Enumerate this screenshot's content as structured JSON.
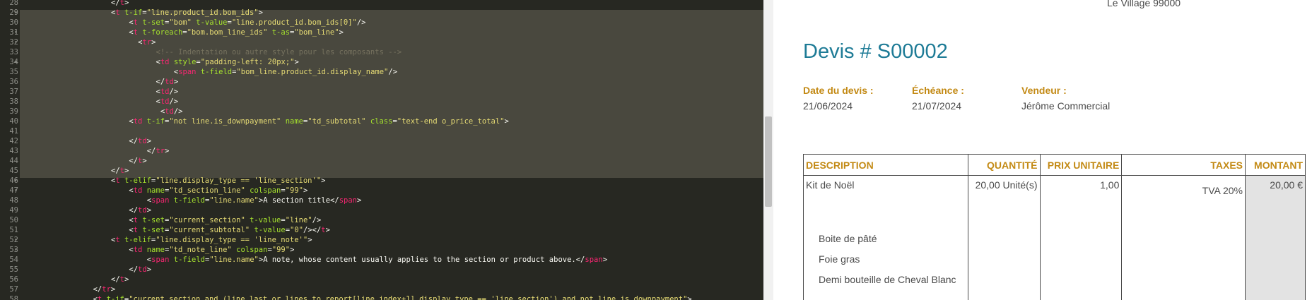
{
  "editor": {
    "lines": [
      {
        "n": "28",
        "fold": "",
        "ind": 20,
        "tokens": [
          [
            "punc",
            "</"
          ],
          [
            "tag",
            "t"
          ],
          [
            "punc",
            ">"
          ]
        ]
      },
      {
        "n": "29",
        "fold": "▾",
        "ind": 20,
        "tokens": [
          [
            "punc",
            "<"
          ],
          [
            "tag",
            "t"
          ],
          [
            "text",
            " "
          ],
          [
            "attr",
            "t-if"
          ],
          [
            "punc",
            "="
          ],
          [
            "str",
            "\"line.product_id.bom_ids\""
          ],
          [
            "punc",
            ">"
          ]
        ]
      },
      {
        "n": "30",
        "fold": "",
        "ind": 24,
        "tokens": [
          [
            "punc",
            "<"
          ],
          [
            "tag",
            "t"
          ],
          [
            "text",
            " "
          ],
          [
            "attr",
            "t-set"
          ],
          [
            "punc",
            "="
          ],
          [
            "str",
            "\"bom\""
          ],
          [
            "text",
            " "
          ],
          [
            "attr",
            "t-value"
          ],
          [
            "punc",
            "="
          ],
          [
            "str",
            "\"line.product_id.bom_ids[0]\""
          ],
          [
            "punc",
            "/>"
          ]
        ]
      },
      {
        "n": "31",
        "fold": "▾",
        "ind": 24,
        "tokens": [
          [
            "punc",
            "<"
          ],
          [
            "tag",
            "t"
          ],
          [
            "text",
            " "
          ],
          [
            "attr",
            "t-foreach"
          ],
          [
            "punc",
            "="
          ],
          [
            "str",
            "\"bom.bom_line_ids\""
          ],
          [
            "text",
            " "
          ],
          [
            "attr",
            "t-as"
          ],
          [
            "punc",
            "="
          ],
          [
            "str",
            "\"bom_line\""
          ],
          [
            "punc",
            ">"
          ]
        ]
      },
      {
        "n": "32",
        "fold": "▾",
        "ind": 26,
        "tokens": [
          [
            "punc",
            "<"
          ],
          [
            "tag",
            "tr"
          ],
          [
            "punc",
            ">"
          ]
        ]
      },
      {
        "n": "33",
        "fold": "",
        "ind": 30,
        "tokens": [
          [
            "com",
            "<!-- Indentation ou autre style pour les composants -->"
          ]
        ]
      },
      {
        "n": "34",
        "fold": "▾",
        "ind": 30,
        "tokens": [
          [
            "punc",
            "<"
          ],
          [
            "tag",
            "td"
          ],
          [
            "text",
            " "
          ],
          [
            "attr",
            "style"
          ],
          [
            "punc",
            "="
          ],
          [
            "str",
            "\"padding-left: 20px;\""
          ],
          [
            "punc",
            ">"
          ]
        ]
      },
      {
        "n": "35",
        "fold": "",
        "ind": 34,
        "tokens": [
          [
            "punc",
            "<"
          ],
          [
            "tag",
            "span"
          ],
          [
            "text",
            " "
          ],
          [
            "attr",
            "t-field"
          ],
          [
            "punc",
            "="
          ],
          [
            "str",
            "\"bom_line.product_id.display_name\""
          ],
          [
            "punc",
            "/>"
          ]
        ]
      },
      {
        "n": "36",
        "fold": "",
        "ind": 30,
        "tokens": [
          [
            "punc",
            "</"
          ],
          [
            "tag",
            "td"
          ],
          [
            "punc",
            ">"
          ]
        ]
      },
      {
        "n": "37",
        "fold": "",
        "ind": 30,
        "tokens": [
          [
            "punc",
            "<"
          ],
          [
            "tag",
            "td"
          ],
          [
            "punc",
            "/>"
          ]
        ]
      },
      {
        "n": "38",
        "fold": "",
        "ind": 30,
        "tokens": [
          [
            "punc",
            "<"
          ],
          [
            "tag",
            "td"
          ],
          [
            "punc",
            "/>"
          ]
        ]
      },
      {
        "n": "39",
        "fold": "",
        "ind": 31,
        "tokens": [
          [
            "punc",
            "<"
          ],
          [
            "tag",
            "td"
          ],
          [
            "punc",
            "/>"
          ]
        ]
      },
      {
        "n": "40",
        "fold": "",
        "ind": 24,
        "tokens": [
          [
            "punc",
            "<"
          ],
          [
            "tag",
            "td"
          ],
          [
            "text",
            " "
          ],
          [
            "attr",
            "t-if"
          ],
          [
            "punc",
            "="
          ],
          [
            "str",
            "\"not line.is_downpayment\""
          ],
          [
            "text",
            " "
          ],
          [
            "attr",
            "name"
          ],
          [
            "punc",
            "="
          ],
          [
            "str",
            "\"td_subtotal\""
          ],
          [
            "text",
            " "
          ],
          [
            "attr",
            "class"
          ],
          [
            "punc",
            "="
          ],
          [
            "str",
            "\"text-end o_price_total\""
          ],
          [
            "punc",
            ">"
          ]
        ]
      },
      {
        "n": "41",
        "fold": "",
        "ind": 0,
        "tokens": []
      },
      {
        "n": "42",
        "fold": "",
        "ind": 24,
        "tokens": [
          [
            "punc",
            "</"
          ],
          [
            "tag",
            "td"
          ],
          [
            "punc",
            ">"
          ]
        ]
      },
      {
        "n": "43",
        "fold": "",
        "ind": 28,
        "tokens": [
          [
            "punc",
            "</"
          ],
          [
            "tag",
            "tr"
          ],
          [
            "punc",
            ">"
          ]
        ]
      },
      {
        "n": "44",
        "fold": "",
        "ind": 24,
        "tokens": [
          [
            "punc",
            "</"
          ],
          [
            "tag",
            "t"
          ],
          [
            "punc",
            ">"
          ]
        ]
      },
      {
        "n": "45",
        "fold": "",
        "ind": 20,
        "tokens": [
          [
            "punc",
            "</"
          ],
          [
            "tag",
            "t"
          ],
          [
            "punc",
            ">"
          ]
        ]
      },
      {
        "n": "46",
        "fold": "▾",
        "ind": 20,
        "tokens": [
          [
            "punc",
            "<"
          ],
          [
            "tag",
            "t"
          ],
          [
            "text",
            " "
          ],
          [
            "attr",
            "t-elif"
          ],
          [
            "punc",
            "="
          ],
          [
            "str",
            "\"line.display_type == 'line_section'\""
          ],
          [
            "punc",
            ">"
          ]
        ]
      },
      {
        "n": "47",
        "fold": "▾",
        "ind": 24,
        "tokens": [
          [
            "punc",
            "<"
          ],
          [
            "tag",
            "td"
          ],
          [
            "text",
            " "
          ],
          [
            "attr",
            "name"
          ],
          [
            "punc",
            "="
          ],
          [
            "str",
            "\"td_section_line\""
          ],
          [
            "text",
            " "
          ],
          [
            "attr",
            "colspan"
          ],
          [
            "punc",
            "="
          ],
          [
            "str",
            "\"99\""
          ],
          [
            "punc",
            ">"
          ]
        ]
      },
      {
        "n": "48",
        "fold": "",
        "ind": 28,
        "tokens": [
          [
            "punc",
            "<"
          ],
          [
            "tag",
            "span"
          ],
          [
            "text",
            " "
          ],
          [
            "attr",
            "t-field"
          ],
          [
            "punc",
            "="
          ],
          [
            "str",
            "\"line.name\""
          ],
          [
            "punc",
            ">"
          ],
          [
            "text",
            "A section title"
          ],
          [
            "punc",
            "</"
          ],
          [
            "tag",
            "span"
          ],
          [
            "punc",
            ">"
          ]
        ]
      },
      {
        "n": "49",
        "fold": "",
        "ind": 24,
        "tokens": [
          [
            "punc",
            "</"
          ],
          [
            "tag",
            "td"
          ],
          [
            "punc",
            ">"
          ]
        ]
      },
      {
        "n": "50",
        "fold": "",
        "ind": 24,
        "tokens": [
          [
            "punc",
            "<"
          ],
          [
            "tag",
            "t"
          ],
          [
            "text",
            " "
          ],
          [
            "attr",
            "t-set"
          ],
          [
            "punc",
            "="
          ],
          [
            "str",
            "\"current_section\""
          ],
          [
            "text",
            " "
          ],
          [
            "attr",
            "t-value"
          ],
          [
            "punc",
            "="
          ],
          [
            "str",
            "\"line\""
          ],
          [
            "punc",
            "/>"
          ]
        ]
      },
      {
        "n": "51",
        "fold": "",
        "ind": 24,
        "tokens": [
          [
            "punc",
            "<"
          ],
          [
            "tag",
            "t"
          ],
          [
            "text",
            " "
          ],
          [
            "attr",
            "t-set"
          ],
          [
            "punc",
            "="
          ],
          [
            "str",
            "\"current_subtotal\""
          ],
          [
            "text",
            " "
          ],
          [
            "attr",
            "t-value"
          ],
          [
            "punc",
            "="
          ],
          [
            "str",
            "\"0\""
          ],
          [
            "punc",
            "/></"
          ],
          [
            "tag",
            "t"
          ],
          [
            "punc",
            ">"
          ]
        ]
      },
      {
        "n": "52",
        "fold": "▾",
        "ind": 20,
        "tokens": [
          [
            "punc",
            "<"
          ],
          [
            "tag",
            "t"
          ],
          [
            "text",
            " "
          ],
          [
            "attr",
            "t-elif"
          ],
          [
            "punc",
            "="
          ],
          [
            "str",
            "\"line.display_type == 'line_note'\""
          ],
          [
            "punc",
            ">"
          ]
        ]
      },
      {
        "n": "53",
        "fold": "▾",
        "ind": 24,
        "tokens": [
          [
            "punc",
            "<"
          ],
          [
            "tag",
            "td"
          ],
          [
            "text",
            " "
          ],
          [
            "attr",
            "name"
          ],
          [
            "punc",
            "="
          ],
          [
            "str",
            "\"td_note_line\""
          ],
          [
            "text",
            " "
          ],
          [
            "attr",
            "colspan"
          ],
          [
            "punc",
            "="
          ],
          [
            "str",
            "\"99\""
          ],
          [
            "punc",
            ">"
          ]
        ]
      },
      {
        "n": "54",
        "fold": "",
        "ind": 28,
        "tokens": [
          [
            "punc",
            "<"
          ],
          [
            "tag",
            "span"
          ],
          [
            "text",
            " "
          ],
          [
            "attr",
            "t-field"
          ],
          [
            "punc",
            "="
          ],
          [
            "str",
            "\"line.name\""
          ],
          [
            "punc",
            ">"
          ],
          [
            "text",
            "A note, whose content usually applies to the section or product above."
          ],
          [
            "punc",
            "</"
          ],
          [
            "tag",
            "span"
          ],
          [
            "punc",
            ">"
          ]
        ]
      },
      {
        "n": "55",
        "fold": "",
        "ind": 24,
        "tokens": [
          [
            "punc",
            "</"
          ],
          [
            "tag",
            "td"
          ],
          [
            "punc",
            ">"
          ]
        ]
      },
      {
        "n": "56",
        "fold": "",
        "ind": 20,
        "tokens": [
          [
            "punc",
            "</"
          ],
          [
            "tag",
            "t"
          ],
          [
            "punc",
            ">"
          ]
        ]
      },
      {
        "n": "57",
        "fold": "",
        "ind": 16,
        "tokens": [
          [
            "punc",
            "</"
          ],
          [
            "tag",
            "tr"
          ],
          [
            "punc",
            ">"
          ]
        ]
      },
      {
        "n": "58",
        "fold": "",
        "ind": 16,
        "tokens": [
          [
            "punc",
            "<"
          ],
          [
            "tag",
            "t"
          ],
          [
            "text",
            " "
          ],
          [
            "attr",
            "t-if"
          ],
          [
            "punc",
            "="
          ],
          [
            "str",
            "\"current_section and (line_last or lines_to_report[line_index+1].display_type == 'line_section') and not line.is_downpayment\""
          ],
          [
            "punc",
            ">"
          ]
        ]
      }
    ]
  },
  "document": {
    "address_line": "Le Village 99000",
    "title": "Devis # S00002",
    "info": [
      {
        "label": "Date du devis :",
        "value": "21/06/2024"
      },
      {
        "label": "Échéance :",
        "value": "21/07/2024"
      },
      {
        "label": "Vendeur :",
        "value": "Jérôme Commercial"
      }
    ],
    "table": {
      "headers": {
        "description": "DESCRIPTION",
        "quantity": "QUANTITÉ",
        "unit_price": "PRIX UNITAIRE",
        "taxes": "TAXES",
        "amount": "MONTANT"
      },
      "row": {
        "description": "Kit de Noël",
        "quantity": "20,00 Unité(s)",
        "unit_price": "1,00",
        "taxes": "TVA 20%",
        "amount": "20,00 €"
      },
      "components": [
        "Boite de pâté",
        "Foie gras",
        "Demi bouteille de Cheval Blanc"
      ]
    }
  }
}
